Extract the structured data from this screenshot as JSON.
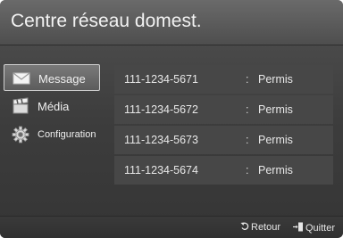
{
  "header": {
    "title": "Centre réseau domest."
  },
  "sidebar": {
    "items": [
      {
        "label": "Message",
        "icon": "envelope-icon"
      },
      {
        "label": "Média",
        "icon": "clapperboard-icon"
      },
      {
        "label": "Configuration",
        "icon": "gear-icon"
      }
    ],
    "selected": "Message"
  },
  "messages": [
    {
      "number": "111-1234-5671",
      "separator": ":",
      "status": "Permis"
    },
    {
      "number": "111-1234-5672",
      "separator": ":",
      "status": "Permis"
    },
    {
      "number": "111-1234-5673",
      "separator": ":",
      "status": "Permis"
    },
    {
      "number": "111-1234-5674",
      "separator": ":",
      "status": "Permis"
    }
  ],
  "footer": {
    "back_label": "Retour",
    "quit_label": "Quitter"
  },
  "colors": {
    "background": "#3d3d3d",
    "row": "#474747",
    "text": "#e8e8e8",
    "selected_border": "#cfcfcf"
  }
}
